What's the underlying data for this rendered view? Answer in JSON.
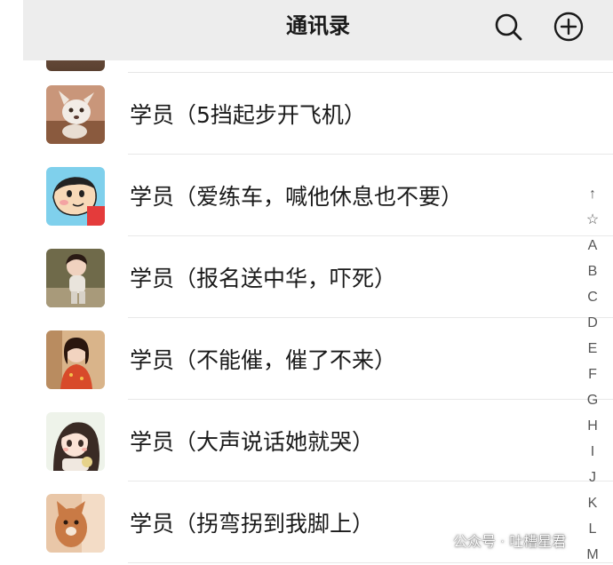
{
  "header": {
    "title": "通讯录",
    "search_icon": "search-icon",
    "add_icon": "add-circle-icon",
    "background": "#ededed"
  },
  "contacts": [
    {
      "name": "学员（5挡起步开飞机）",
      "avatar": "avatar-dog-photo"
    },
    {
      "name": "学员（爱练车，喊他休息也不要）",
      "avatar": "avatar-crayon-shinchan"
    },
    {
      "name": "学员（报名送中华，吓死）",
      "avatar": "avatar-child-photo"
    },
    {
      "name": "学员（不能催，催了不来）",
      "avatar": "avatar-girl-photo"
    },
    {
      "name": "学员（大声说话她就哭）",
      "avatar": "avatar-anime-girl"
    },
    {
      "name": "学员（拐弯拐到我脚上）",
      "avatar": "avatar-cat-photo"
    }
  ],
  "index_bar": [
    "↑",
    "☆",
    "A",
    "B",
    "C",
    "D",
    "E",
    "F",
    "G",
    "H",
    "I",
    "J",
    "K",
    "L",
    "M"
  ],
  "watermark": {
    "text": "公众号 · 吐槽星君",
    "icon": "wechat-official-account-icon"
  }
}
